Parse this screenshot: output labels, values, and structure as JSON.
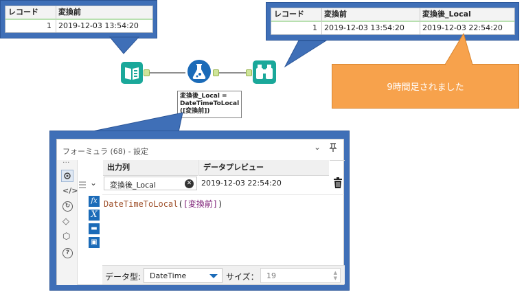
{
  "left_table": {
    "headers": [
      "レコード",
      "変換前"
    ],
    "rows": [
      [
        "1",
        "2019-12-03 13:54:20"
      ]
    ]
  },
  "right_table": {
    "headers": [
      "レコード",
      "変換前",
      "変換後_Local"
    ],
    "rows": [
      [
        "1",
        "2019-12-03 13:54:20",
        "2019-12-03 22:54:20"
      ]
    ]
  },
  "note": {
    "text": "9時間足されました"
  },
  "annotation": {
    "text": "変換後_Local =\nDateTimeToLocal\n([変換前])"
  },
  "config": {
    "title": "フォーミュラ (68) - 設定",
    "more_dots": "...",
    "col_output": "出力列",
    "col_preview": "データプレビュー",
    "field_value": "変換後_Local",
    "preview_value": "2019-12-03 22:54:20",
    "expr_func": "DateTimeToLocal",
    "expr_open": "(",
    "expr_field": "[変換前]",
    "expr_close": ")",
    "type_label": "データ型:",
    "type_value": "DateTime",
    "size_label": "サイズ：",
    "size_value": "19"
  },
  "colors": {
    "accent_blue": "#3f6fb7",
    "note_orange": "#f7a24c",
    "tool_teal": "#1aa89a",
    "formula_blue": "#1b6bb8"
  }
}
